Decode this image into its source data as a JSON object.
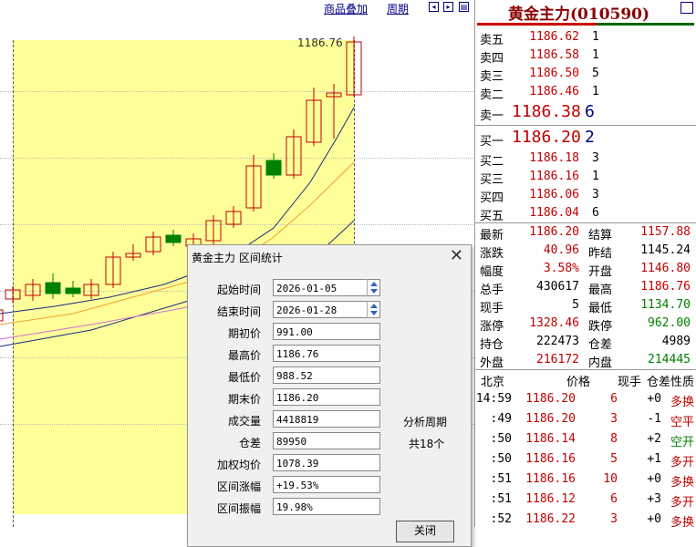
{
  "toolbar": {
    "overlay_label": "商品叠加",
    "period_label": "周期"
  },
  "chart": {
    "high_price_label": "1186.76"
  },
  "dialog": {
    "title": "黄金主力 区间统计",
    "fields": [
      {
        "label": "起始时间",
        "value": "2026-01-05"
      },
      {
        "label": "结束时间",
        "value": "2026-01-28"
      },
      {
        "label": "期初价",
        "value": "991.00"
      },
      {
        "label": "最高价",
        "value": "1186.76"
      },
      {
        "label": "最低价",
        "value": "988.52"
      },
      {
        "label": "期末价",
        "value": "1186.20"
      },
      {
        "label": "成交量",
        "value": "4418819"
      },
      {
        "label": "仓差",
        "value": "89950"
      },
      {
        "label": "加权均价",
        "value": "1078.39"
      },
      {
        "label": "区间涨幅",
        "value": "+19.53%"
      },
      {
        "label": "区间振幅",
        "value": "19.98%"
      }
    ],
    "analysis_period_label": "分析周期",
    "period_count": "共18个",
    "close_button": "关闭"
  },
  "panel": {
    "title": "黄金主力(010590)",
    "asks": [
      {
        "label": "卖五",
        "price": "1186.62",
        "volume": "1"
      },
      {
        "label": "卖四",
        "price": "1186.58",
        "volume": "1"
      },
      {
        "label": "卖三",
        "price": "1186.50",
        "volume": "5"
      },
      {
        "label": "卖二",
        "price": "1186.46",
        "volume": "1"
      },
      {
        "label": "卖一",
        "price": "1186.38",
        "volume": "6"
      }
    ],
    "bids": [
      {
        "label": "买一",
        "price": "1186.20",
        "volume": "2"
      },
      {
        "label": "买二",
        "price": "1186.18",
        "volume": "3"
      },
      {
        "label": "买三",
        "price": "1186.16",
        "volume": "1"
      },
      {
        "label": "买四",
        "price": "1186.06",
        "volume": "3"
      },
      {
        "label": "买五",
        "price": "1186.04",
        "volume": "6"
      }
    ],
    "stats": [
      {
        "l1": "最新",
        "v1": "1186.20",
        "c1": "#c00000",
        "l2": "结算",
        "v2": "1157.88",
        "c2": "#c00000"
      },
      {
        "l1": "涨跌",
        "v1": "40.96",
        "c1": "#c00000",
        "l2": "昨结",
        "v2": "1145.24",
        "c2": "#000000"
      },
      {
        "l1": "幅度",
        "v1": "3.58%",
        "c1": "#c00000",
        "l2": "开盘",
        "v2": "1146.80",
        "c2": "#c00000"
      },
      {
        "l1": "总手",
        "v1": "430617",
        "c1": "#000000",
        "l2": "最高",
        "v2": "1186.76",
        "c2": "#c00000"
      },
      {
        "l1": "现手",
        "v1": "5",
        "c1": "#000000",
        "l2": "最低",
        "v2": "1134.70",
        "c2": "#008000"
      },
      {
        "l1": "涨停",
        "v1": "1328.46",
        "c1": "#c00000",
        "l2": "跌停",
        "v2": "962.00",
        "c2": "#008000"
      },
      {
        "l1": "持仓",
        "v1": "222473",
        "c1": "#000000",
        "l2": "仓差",
        "v2": "4989",
        "c2": "#000000"
      },
      {
        "l1": "外盘",
        "v1": "216172",
        "c1": "#c00000",
        "l2": "内盘",
        "v2": "214445",
        "c2": "#008000"
      }
    ],
    "ticks_header": {
      "loc": "北京",
      "price": "价格",
      "hand": "现手",
      "diff": "仓差",
      "nature": "性质"
    },
    "ticks": [
      {
        "time": "14:59",
        "price": "1186.20",
        "hand": "6",
        "diff": "+0",
        "nature": "多换",
        "ncolor": "#c00000"
      },
      {
        "time": ":49",
        "price": "1186.20",
        "hand": "3",
        "diff": "-1",
        "nature": "空平",
        "ncolor": "#c00000"
      },
      {
        "time": ":50",
        "price": "1186.14",
        "hand": "8",
        "diff": "+2",
        "nature": "空开",
        "ncolor": "#008000"
      },
      {
        "time": ":50",
        "price": "1186.16",
        "hand": "5",
        "diff": "+1",
        "nature": "多开",
        "ncolor": "#c00000"
      },
      {
        "time": ":51",
        "price": "1186.16",
        "hand": "10",
        "diff": "+0",
        "nature": "多换",
        "ncolor": "#c00000"
      },
      {
        "time": ":51",
        "price": "1186.12",
        "hand": "6",
        "diff": "+3",
        "nature": "多开",
        "ncolor": "#c00000"
      },
      {
        "time": ":52",
        "price": "1186.22",
        "hand": "3",
        "diff": "+0",
        "nature": "多换",
        "ncolor": "#c00000"
      }
    ]
  },
  "colors": {
    "up": "#c00000",
    "down": "#008000",
    "highlight": "#ffff99",
    "ma_dark": "#1a2a80",
    "ma_orange": "#f0a030",
    "ma_pink": "#d070d0"
  }
}
